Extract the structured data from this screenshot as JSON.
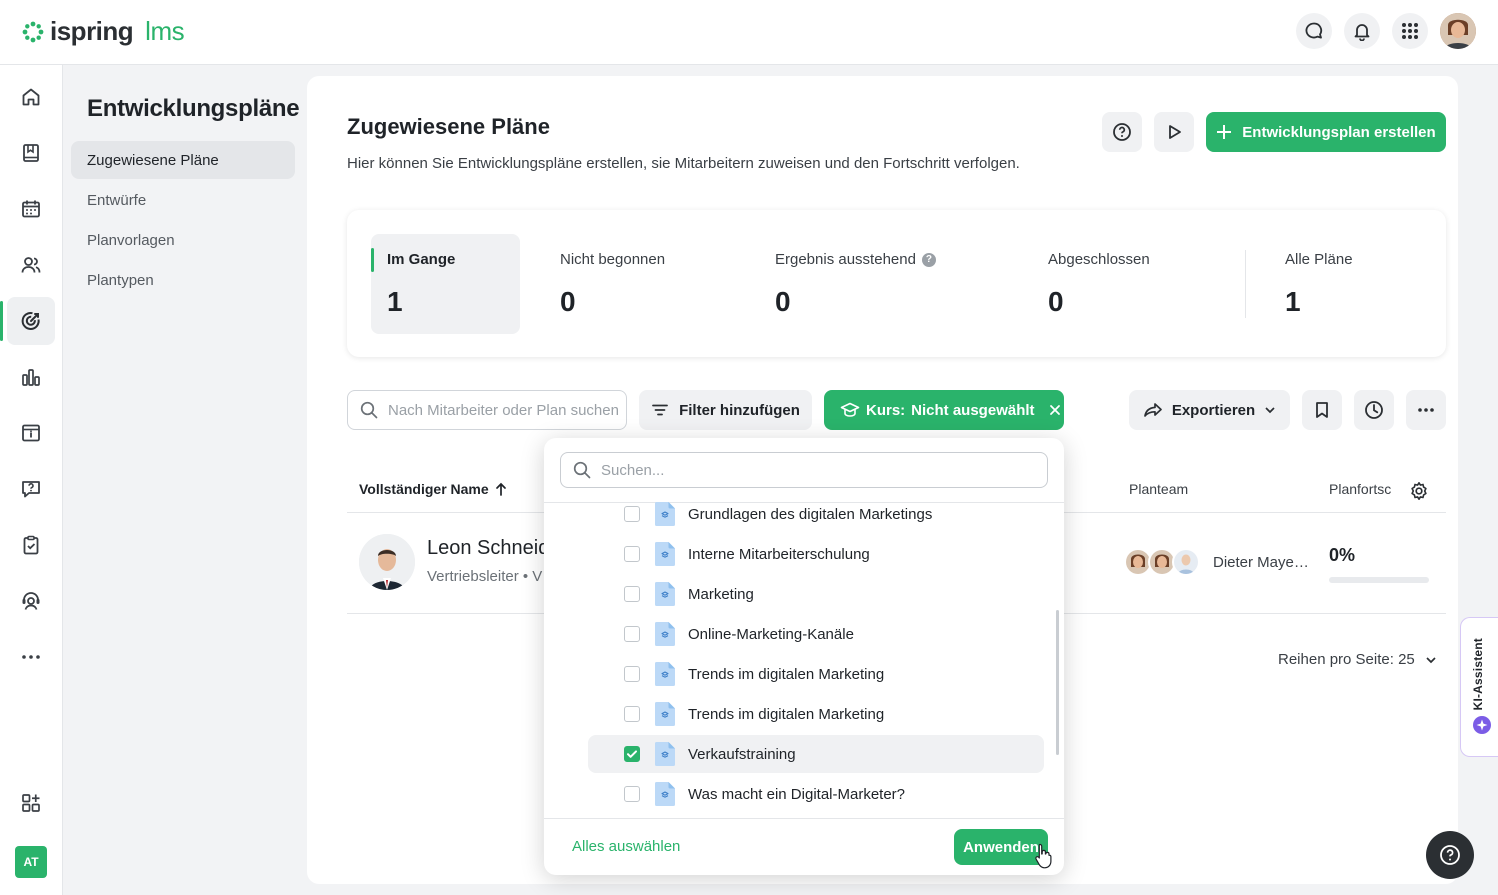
{
  "brand": {
    "name_part1": "ispring",
    "name_part2": "lms",
    "accent": "#2ab36b"
  },
  "topbar": {
    "icons": [
      "chat-icon",
      "bell-icon",
      "apps-grid-icon"
    ],
    "avatar": "user-avatar"
  },
  "iconbar": {
    "items": [
      "home-icon",
      "book-icon",
      "calendar-icon",
      "users-icon",
      "target-icon",
      "chart-icon",
      "info-board-icon",
      "question-chat-icon",
      "clipboard-check-icon",
      "support-person-icon",
      "more-dots-icon"
    ],
    "active": "target-icon",
    "bottom": [
      "add-widget-icon"
    ],
    "user_initials": "AT"
  },
  "subnav": {
    "title": "Entwicklungspläne",
    "items": [
      {
        "label": "Zugewiesene Pläne",
        "active": true
      },
      {
        "label": "Entwürfe"
      },
      {
        "label": "Planvorlagen"
      },
      {
        "label": "Plantypen"
      }
    ]
  },
  "header": {
    "title": "Zugewiesene Pläne",
    "description": "Hier können Sie Entwicklungspläne erstellen, sie Mitarbeitern zuweisen und den Fortschritt verfolgen.",
    "create_label": "Entwicklungsplan erstellen"
  },
  "stats": [
    {
      "label": "Im Gange",
      "value": "1",
      "active": true
    },
    {
      "label": "Nicht begonnen",
      "value": "0"
    },
    {
      "label": "Ergebnis ausstehend",
      "value": "0"
    },
    {
      "label": "Abgeschlossen",
      "value": "0"
    },
    {
      "label": "Alle Pläne",
      "value": "1"
    }
  ],
  "toolbar": {
    "search_placeholder": "Nach Mitarbeiter oder Plan suchen",
    "filter_label": "Filter hinzufügen",
    "kurs_label": "Kurs:",
    "kurs_value": "Nicht ausgewählt",
    "export_label": "Exportieren"
  },
  "table": {
    "columns": {
      "name": "Vollständiger Name",
      "team": "Planteam",
      "progress": "Planfortschritt"
    },
    "rows": [
      {
        "name": "Leon Schneider",
        "subtitle": "Vertriebsleiter • V",
        "team_label": "Dieter Maye…",
        "progress": "0%",
        "progress_fraction": 0
      }
    ],
    "rows_per_page": "Reihen pro Seite: 25"
  },
  "ki_assistant": {
    "label": "KI-Assistent"
  },
  "dropdown": {
    "search_placeholder": "Suchen...",
    "items": [
      {
        "label": "Grundlagen des digitalen Marketings",
        "checked": false
      },
      {
        "label": "Interne Mitarbeiterschulung",
        "checked": false
      },
      {
        "label": "Marketing",
        "checked": false
      },
      {
        "label": "Online-Marketing-Kanäle",
        "checked": false
      },
      {
        "label": "Trends im digitalen Marketing",
        "checked": false
      },
      {
        "label": "Trends im digitalen Marketing",
        "checked": false
      },
      {
        "label": "Verkaufstraining",
        "checked": true
      },
      {
        "label": "Was macht ein Digital-Marketer?",
        "checked": false
      }
    ],
    "select_all_label": "Alles auswählen",
    "apply_label": "Anwenden"
  }
}
